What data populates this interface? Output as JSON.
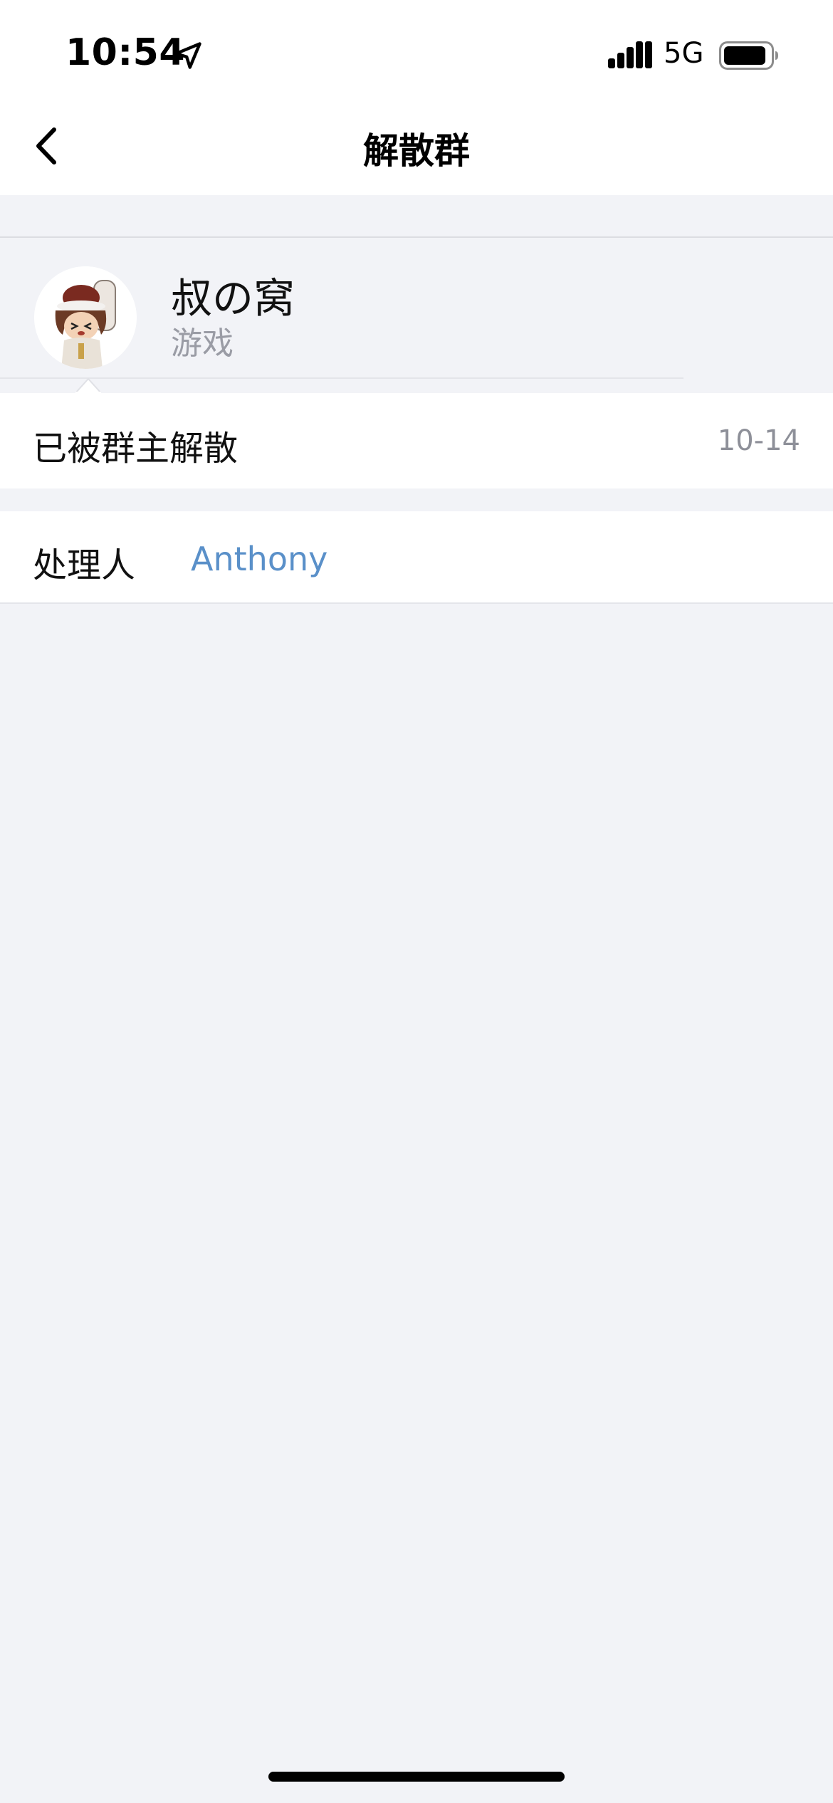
{
  "status_bar": {
    "time": "10:54",
    "network": "5G"
  },
  "nav": {
    "title": "解散群"
  },
  "group": {
    "name": "叔の窝",
    "category": "游戏"
  },
  "notice": {
    "text": "已被群主解散",
    "date": "10-14"
  },
  "handler": {
    "label": "处理人",
    "name": "Anthony"
  },
  "colors": {
    "link": "#5a90c9",
    "background": "#f2f3f7",
    "secondary_text": "#9a9ca5"
  },
  "icons": {
    "back": "chevron-left-icon",
    "location": "location-arrow-icon",
    "signal": "cellular-signal-icon",
    "battery": "battery-icon"
  }
}
